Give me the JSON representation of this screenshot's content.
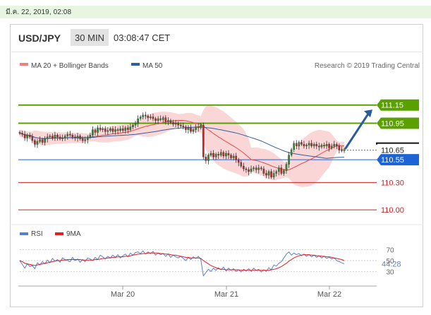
{
  "date_bar": {
    "text": "มี.ค. 22, 2019, 02:08"
  },
  "header": {
    "pair": "USD/JPY",
    "timeframe": "30 MIN",
    "time": "03:08:47 CET"
  },
  "legend": [
    {
      "name": "MA 20 + Bollinger Bands",
      "color": "#f08080"
    },
    {
      "name": "MA 50",
      "color": "#2f5f9e"
    }
  ],
  "credit": "Research © 2019 Trading Central",
  "rsi_legend": [
    {
      "name": "RSI",
      "color": "#5b7fd0"
    },
    {
      "name": "9MA",
      "color": "#e02020"
    }
  ],
  "colors": {
    "resistance": "#5aa000",
    "support": "#1e63d6",
    "target_line": "#cc2222",
    "arrow": "#2a5aa0",
    "current_box": "#111111",
    "band_fill": "#f8c8c8",
    "ma20": "#e24a4a",
    "ma50": "#2f5f9e"
  },
  "chart_data": [
    {
      "type": "candlestick",
      "ylim": [
        109.9,
        111.45
      ],
      "x_ticks": [
        "Mar 20",
        "Mar 21",
        "Mar 22"
      ],
      "levels": [
        {
          "label": "111.15",
          "value": 111.15,
          "kind": "resistance"
        },
        {
          "label": "110.95",
          "value": 110.95,
          "kind": "resistance"
        },
        {
          "label": "110.65",
          "value": 110.655,
          "kind": "current"
        },
        {
          "label": "110.55",
          "value": 110.55,
          "kind": "support"
        },
        {
          "label": "110.30",
          "value": 110.3,
          "kind": "target"
        },
        {
          "label": "110.00",
          "value": 110.0,
          "kind": "target"
        }
      ],
      "close": [
        110.84,
        110.83,
        110.79,
        110.82,
        110.8,
        110.76,
        110.72,
        110.75,
        110.77,
        110.74,
        110.78,
        110.8,
        110.81,
        110.79,
        110.82,
        110.8,
        110.78,
        110.79,
        110.81,
        110.83,
        110.82,
        110.8,
        110.79,
        110.81,
        110.78,
        110.76,
        110.77,
        110.8,
        110.82,
        110.88,
        110.85,
        110.9,
        110.88,
        110.89,
        110.86,
        110.87,
        110.89,
        110.86,
        110.88,
        110.87,
        110.89,
        110.87,
        110.9,
        110.88,
        110.91,
        110.93,
        110.95,
        111.0,
        111.02,
        111.04,
        111.03,
        111.01,
        111.02,
        111.0,
        110.98,
        111.0,
        110.99,
        111.01,
        110.97,
        110.98,
        110.96,
        110.94,
        110.95,
        110.93,
        110.92,
        110.91,
        110.88,
        110.9,
        110.86,
        110.88,
        110.91,
        110.9,
        110.93,
        110.58,
        110.54,
        110.6,
        110.62,
        110.58,
        110.61,
        110.6,
        110.63,
        110.59,
        110.62,
        110.6,
        110.57,
        110.59,
        110.55,
        110.52,
        110.48,
        110.45,
        110.44,
        110.42,
        110.45,
        110.46,
        110.44,
        110.46,
        110.45,
        110.4,
        110.38,
        110.42,
        110.36,
        110.4,
        110.42,
        110.46,
        110.4,
        110.43,
        110.5,
        110.6,
        110.66,
        110.73,
        110.7,
        110.74,
        110.72,
        110.7,
        110.71,
        110.73,
        110.7,
        110.72,
        110.7,
        110.69,
        110.71,
        110.7,
        110.72,
        110.68,
        110.7,
        110.72,
        110.7,
        110.66,
        110.65,
        110.66
      ],
      "rsi": {
        "yticks": [
          70,
          50,
          30
        ],
        "current_label": "44.28",
        "rsi": [
          50,
          43,
          36,
          44,
          39,
          41,
          35,
          46,
          42,
          48,
          44,
          51,
          46,
          54,
          49,
          52,
          47,
          55,
          52,
          50,
          48,
          56,
          50,
          53,
          47,
          52,
          48,
          55,
          53,
          50,
          56,
          52,
          60,
          57,
          53,
          58,
          55,
          60,
          56,
          61,
          55,
          59,
          62,
          57,
          64,
          60,
          65,
          66,
          63,
          68,
          62,
          66,
          63,
          67,
          60,
          64,
          61,
          63,
          58,
          62,
          56,
          60,
          57,
          55,
          58,
          54,
          50,
          56,
          52,
          57,
          54,
          58,
          52,
          22,
          28,
          34,
          30,
          36,
          32,
          37,
          33,
          38,
          31,
          36,
          32,
          35,
          30,
          33,
          29,
          34,
          31,
          35,
          30,
          36,
          32,
          34,
          29,
          33,
          30,
          37,
          33,
          42,
          40,
          45,
          48,
          55,
          62,
          66,
          60,
          64,
          61,
          63,
          59,
          62,
          58,
          61,
          57,
          60,
          56,
          59,
          55,
          58,
          54,
          56,
          53,
          55,
          50,
          48,
          46,
          44
        ],
        "ma9": [
          50,
          48,
          45,
          44,
          43,
          42,
          41,
          42,
          43,
          44,
          45,
          46,
          47,
          48,
          49,
          50,
          50,
          51,
          51,
          52,
          52,
          52,
          52,
          52,
          52,
          51,
          51,
          51,
          51,
          51,
          52,
          52,
          53,
          54,
          54,
          55,
          55,
          56,
          56,
          57,
          57,
          57,
          58,
          58,
          59,
          60,
          61,
          62,
          62,
          63,
          63,
          64,
          64,
          64,
          64,
          64,
          63,
          63,
          62,
          62,
          61,
          60,
          60,
          59,
          58,
          57,
          56,
          56,
          55,
          55,
          55,
          55,
          54,
          50,
          47,
          44,
          41,
          39,
          37,
          35,
          34,
          34,
          33,
          33,
          33,
          33,
          33,
          33,
          32,
          32,
          32,
          32,
          32,
          32,
          32,
          32,
          32,
          32,
          32,
          32,
          33,
          34,
          35,
          37,
          39,
          42,
          45,
          49,
          52,
          55,
          57,
          59,
          60,
          61,
          61,
          61,
          60,
          60,
          59,
          59,
          58,
          58,
          57,
          57,
          56,
          55,
          54,
          53,
          52,
          50
        ]
      }
    }
  ]
}
